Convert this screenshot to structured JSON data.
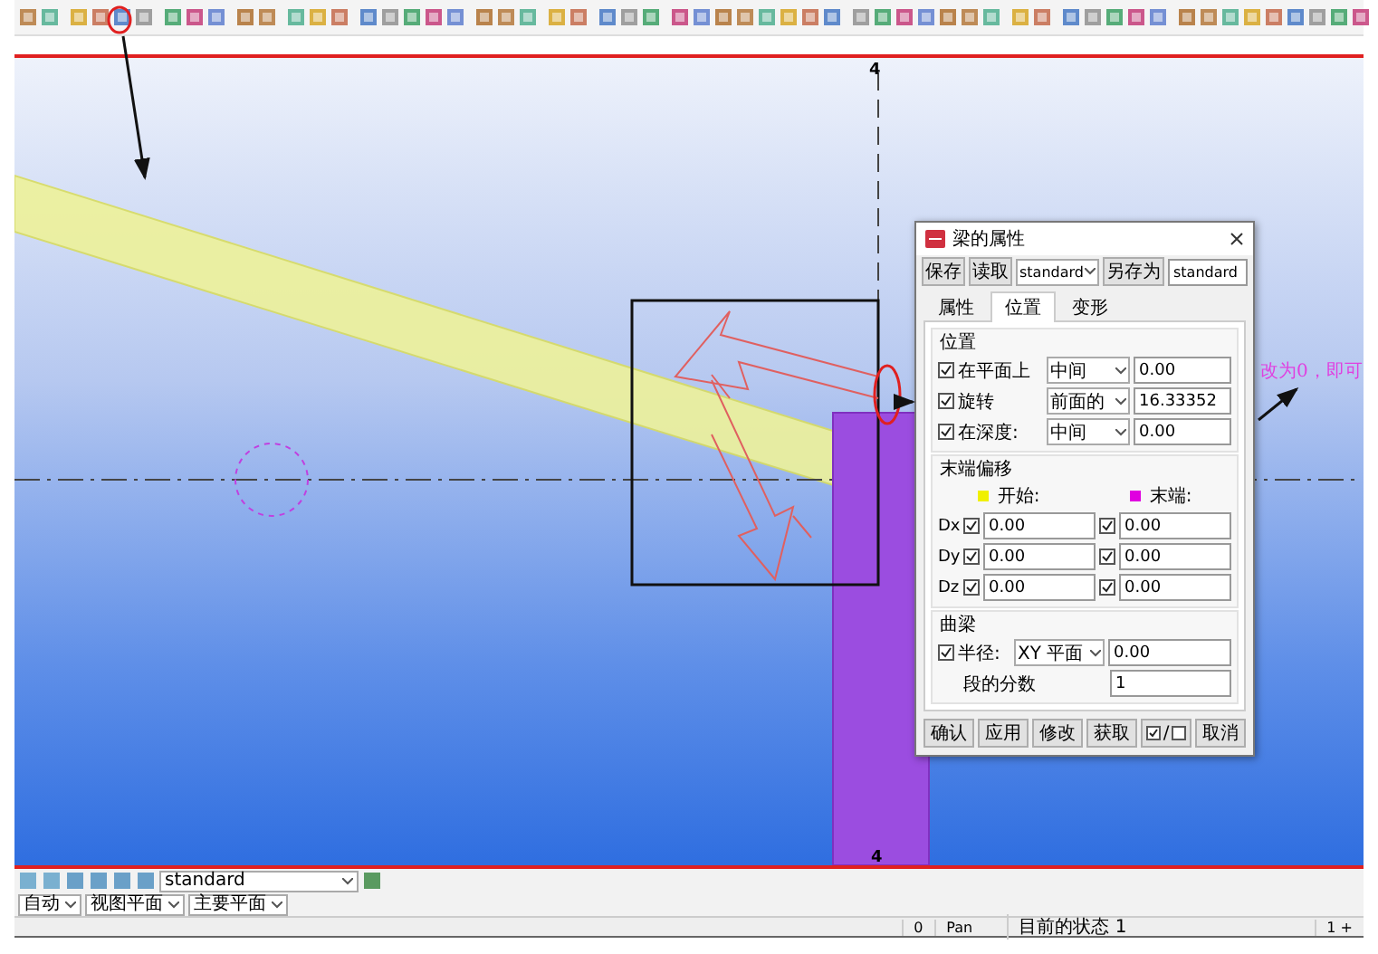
{
  "viewport": {
    "grid_labels": [
      "4",
      "4"
    ],
    "annotation": "改为0，即可"
  },
  "dialog": {
    "title": "梁的属性",
    "save": "保存",
    "load": "读取",
    "preset": "standard",
    "save_as": "另存为",
    "save_as_name": "standard",
    "tabs": [
      {
        "label": "属性",
        "selected": false
      },
      {
        "label": "位置",
        "selected": true
      },
      {
        "label": "变形",
        "selected": false
      }
    ],
    "position": {
      "heading": "位置",
      "rows": [
        {
          "label": "在平面上",
          "checked": true,
          "option": "中间",
          "value": "0.00"
        },
        {
          "label": "旋转",
          "checked": true,
          "option": "前面的",
          "value": "16.33352"
        },
        {
          "label": "在深度:",
          "checked": true,
          "option": "中间",
          "value": "0.00"
        }
      ]
    },
    "end_offset": {
      "heading": "末端偏移",
      "ends": [
        {
          "label": "开始:",
          "color": "#f0f000"
        },
        {
          "label": "末端:",
          "color": "#e000e0"
        }
      ],
      "rows": [
        {
          "axis": "Dx",
          "start_checked": true,
          "start": "0.00",
          "end_checked": true,
          "end": "0.00"
        },
        {
          "axis": "Dy",
          "start_checked": true,
          "start": "0.00",
          "end_checked": true,
          "end": "0.00"
        },
        {
          "axis": "Dz",
          "start_checked": true,
          "start": "0.00",
          "end_checked": true,
          "end": "0.00"
        }
      ]
    },
    "curve": {
      "heading": "曲梁",
      "radius_label": "半径:",
      "radius_checked": true,
      "plane": "XY 平面",
      "radius": "0.00",
      "segments_label": "段的分数",
      "segments": "1"
    },
    "buttons": [
      {
        "kind": "text",
        "label": "确认"
      },
      {
        "kind": "text",
        "label": "应用"
      },
      {
        "kind": "text",
        "label": "修改"
      },
      {
        "kind": "text",
        "label": "获取"
      },
      {
        "kind": "toggle",
        "label": "/"
      },
      {
        "kind": "text",
        "label": "取消"
      }
    ]
  },
  "bottom": {
    "preset": "standard",
    "selects": [
      "自动",
      "视图平面",
      "主要平面"
    ]
  },
  "status": [
    "0",
    "Pan",
    "目前的状态 1",
    "1 +"
  ]
}
